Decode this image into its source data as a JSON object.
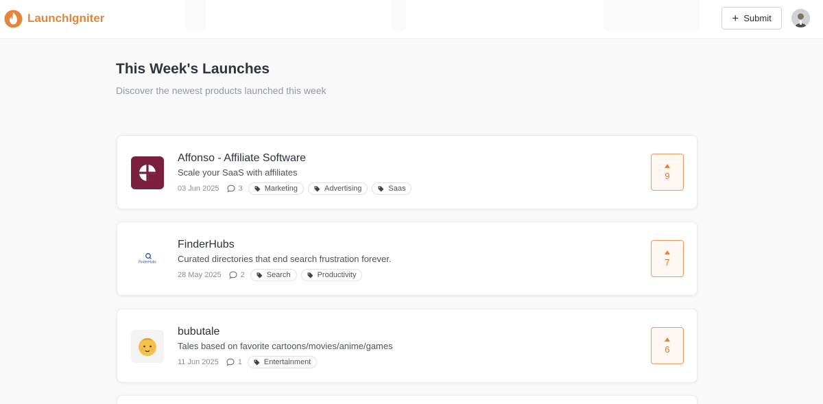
{
  "header": {
    "brand": "LaunchIgniter",
    "submit_label": "Submit",
    "colors": {
      "brand": "#e5853a",
      "accent": "#e57f3b"
    }
  },
  "main": {
    "title": "This Week's Launches",
    "subtitle": "Discover the newest products launched this week"
  },
  "products": [
    {
      "name": "Affonso - Affiliate Software",
      "tagline": "Scale your SaaS with affiliates",
      "date": "03 Jun 2025",
      "comments": "3",
      "tags": [
        "Marketing",
        "Advertising",
        "Saas"
      ],
      "votes": "9",
      "icon": "affonso-logo"
    },
    {
      "name": "FinderHubs",
      "tagline": "Curated directories that end search frustration forever.",
      "date": "28 May 2025",
      "comments": "2",
      "tags": [
        "Search",
        "Productivity"
      ],
      "votes": "7",
      "icon": "finderhubs-logo",
      "logo_text": "FinderHubs"
    },
    {
      "name": "bubutale",
      "tagline": "Tales based on favorite cartoons/movies/anime/games",
      "date": "11 Jun 2025",
      "comments": "1",
      "tags": [
        "Entertainment"
      ],
      "votes": "6",
      "icon": "baby-face-logo"
    }
  ]
}
